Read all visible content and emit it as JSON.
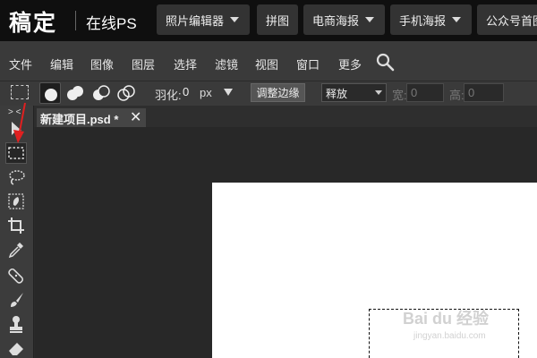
{
  "brand": {
    "logo": "稿定",
    "subtitle": "在线PS"
  },
  "top_nav": [
    {
      "label": "照片编辑器",
      "dropdown": true
    },
    {
      "label": "拼图",
      "dropdown": false
    },
    {
      "label": "电商海报",
      "dropdown": true
    },
    {
      "label": "手机海报",
      "dropdown": true
    },
    {
      "label": "公众号首图",
      "dropdown": false
    }
  ],
  "menu": [
    "文件",
    "编辑",
    "图像",
    "图层",
    "选择",
    "滤镜",
    "视图",
    "窗口",
    "更多"
  ],
  "options": {
    "feather_label": "羽化:",
    "feather_value": "0",
    "feather_unit": "px",
    "refine_edge": "调整边缘",
    "style_value": "释放",
    "width_label": "宽:",
    "width_value": "0",
    "height_label": "高:",
    "height_value": "0"
  },
  "tab": {
    "title": "新建项目.psd *",
    "close": "✕"
  },
  "toolbox_expand": "> <",
  "watermark": {
    "brand": "Bai du 经验",
    "url": "jingyan.baidu.com"
  },
  "colors": {
    "top_bar": "#0f0f0f",
    "menu_bar": "#3a3a3a",
    "workspace": "#282828",
    "canvas": "#ffffff",
    "annotation": "#e02020"
  }
}
